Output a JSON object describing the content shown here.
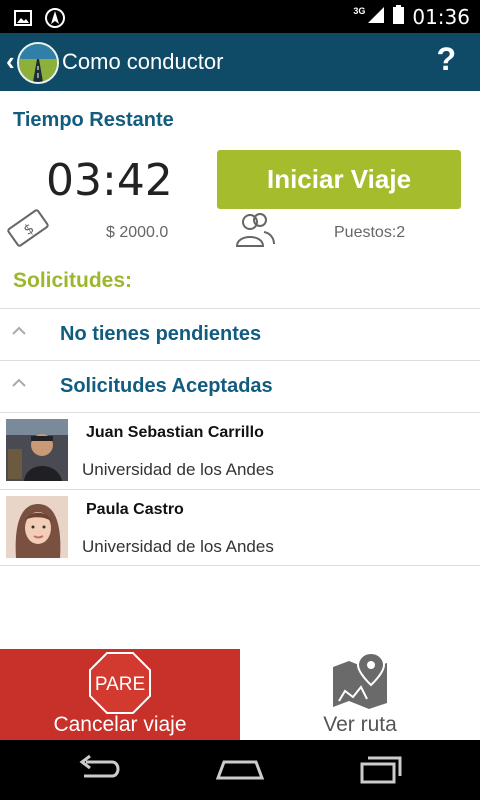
{
  "status_bar": {
    "time": "01:36",
    "network": "3G"
  },
  "action_bar": {
    "title": "Como conductor",
    "help": "?"
  },
  "trip": {
    "remaining_label": "Tiempo Restante",
    "timer": "03:42",
    "start_button": "Iniciar Viaje",
    "price": "$ 2000.0",
    "seats": "Puestos:2"
  },
  "requests": {
    "heading": "Solicitudes:",
    "pending_group": "No tienes pendientes",
    "accepted_group": "Solicitudes Aceptadas",
    "accepted": [
      {
        "name": "Juan Sebastian Carrillo",
        "university": "Universidad de los Andes"
      },
      {
        "name": "Paula Castro",
        "university": "Universidad de los Andes"
      }
    ]
  },
  "bottom_actions": {
    "stop_sign": "PARE",
    "cancel_label": "Cancelar viaje",
    "route_label": "Ver ruta"
  },
  "icons": [
    "gallery-icon",
    "navigation-icon",
    "signal-icon",
    "battery-icon",
    "back-arrow-icon",
    "app-logo-icon",
    "money-icon",
    "people-icon",
    "chevron-up-icon",
    "stop-sign-icon",
    "map-pin-icon",
    "nav-back-icon",
    "nav-home-icon",
    "nav-recents-icon"
  ],
  "colors": {
    "action_bar": "#0f4a67",
    "accent_green": "#a5bd2c",
    "heading_blue": "#125c80",
    "cancel_red": "#c8302a"
  }
}
